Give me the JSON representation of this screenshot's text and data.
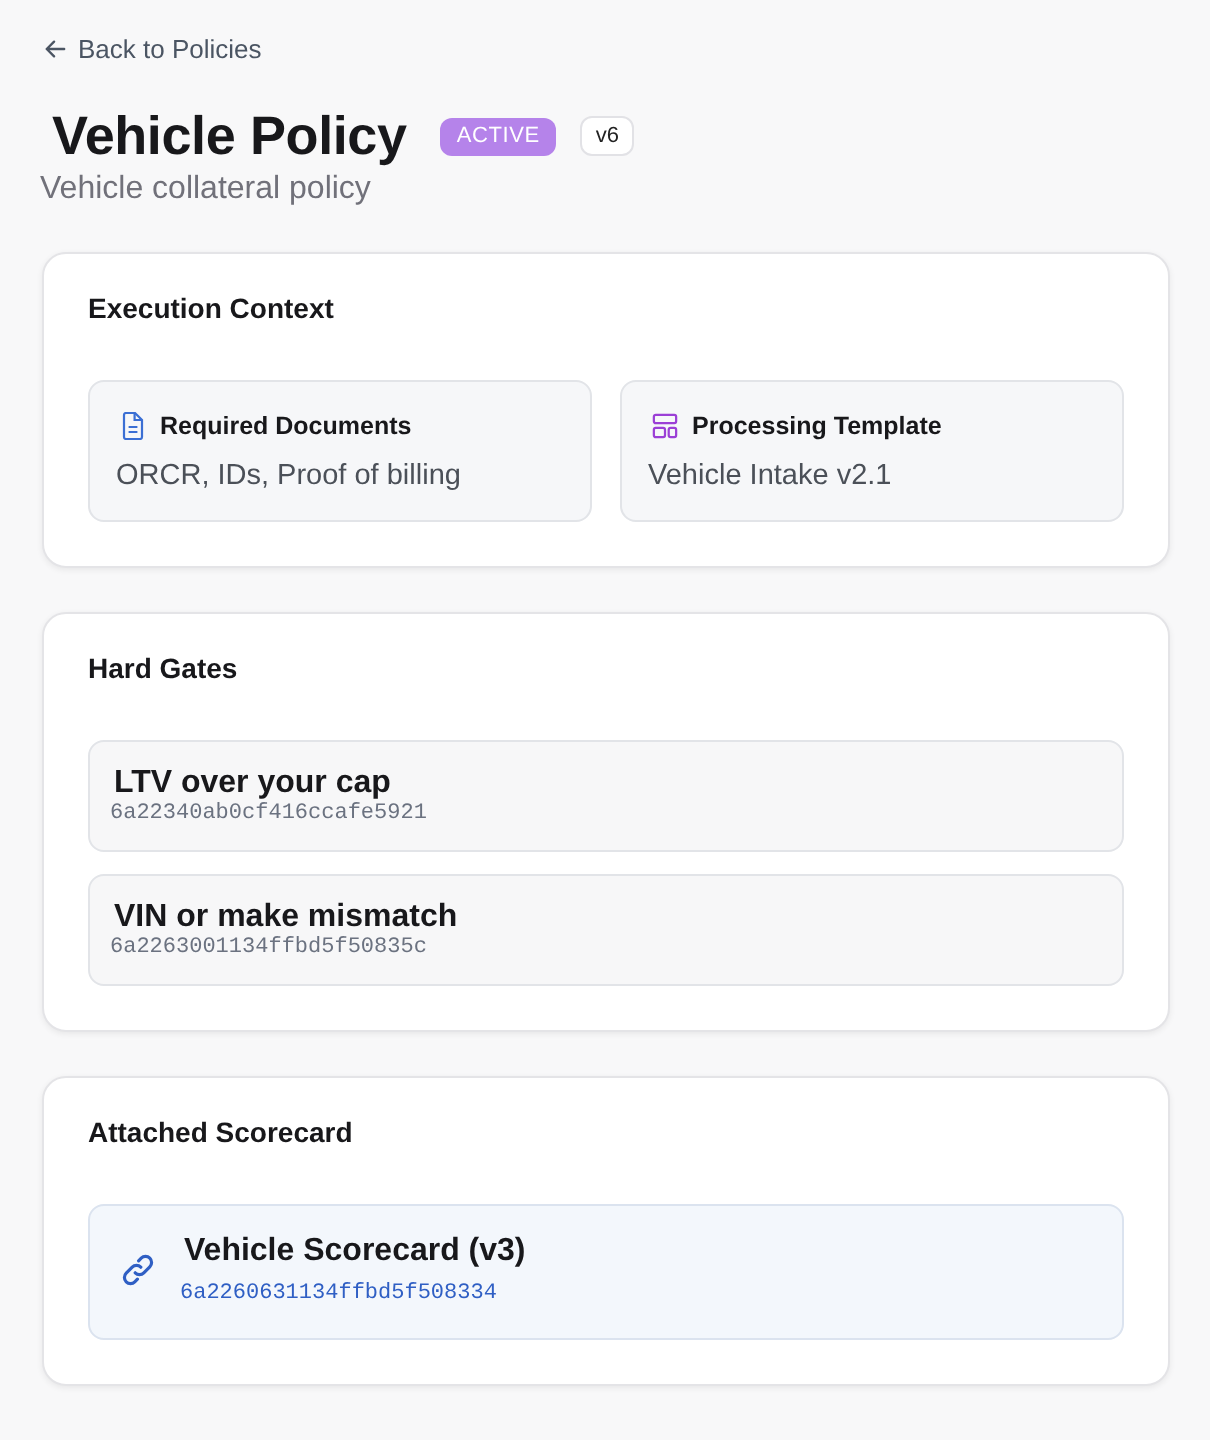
{
  "back_link": {
    "label": "Back to Policies"
  },
  "header": {
    "title": "Vehicle Policy",
    "status": {
      "label": "ACTIVE",
      "kind": "active"
    },
    "version": "v6",
    "subtitle": "Vehicle collateral policy"
  },
  "execution_context": {
    "title": "Execution Context",
    "items": [
      {
        "kind": "documents",
        "label": "Required Documents",
        "value": "ORCR, IDs, Proof of billing"
      },
      {
        "kind": "template",
        "label": "Processing Template",
        "value": "Vehicle Intake v2.1"
      }
    ]
  },
  "hard_gates": {
    "title": "Hard Gates",
    "items": [
      {
        "name": "LTV over your cap",
        "id": "6a22340ab0cf416ccafe5921"
      },
      {
        "name": "VIN or make mismatch",
        "id": "6a2263001134ffbd5f50835c"
      }
    ]
  },
  "scorecard": {
    "title": "Attached Scorecard",
    "name": "Vehicle Scorecard (v3)",
    "id": "6a2260631134ffbd5f508334"
  }
}
